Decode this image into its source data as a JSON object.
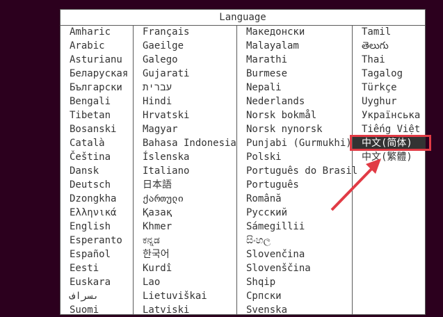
{
  "dialog": {
    "title": "Language",
    "columns": [
      [
        "Amharic",
        "Arabic",
        "Asturianu",
        "Беларуская",
        "Български",
        "Bengali",
        "Tibetan",
        "Bosanski",
        "Català",
        "Čeština",
        "Dansk",
        "Deutsch",
        "Dzongkha",
        "Ελληνικά",
        "English",
        "Esperanto",
        "Español",
        "Eesti",
        "Euskara",
        "ىسراف",
        "Suomi"
      ],
      [
        "Français",
        "Gaeilge",
        "Galego",
        "Gujarati",
        "עברית",
        "Hindi",
        "Hrvatski",
        "Magyar",
        "Bahasa Indonesia",
        "Íslenska",
        "Italiano",
        "日本語",
        "ქართული",
        "Қазақ",
        "Khmer",
        "ಕನ್ನಡ",
        "한국어",
        "Kurdî",
        "Lao",
        "Lietuviškai",
        "Latviski"
      ],
      [
        "Македонски",
        "Malayalam",
        "Marathi",
        "Burmese",
        "Nepali",
        "Nederlands",
        "Norsk bokmål",
        "Norsk nynorsk",
        "Punjabi (Gurmukhi)",
        "Polski",
        "Português do Brasil",
        "Português",
        "Română",
        "Русский",
        "Sámegillii",
        "සිංහල",
        "Slovenčina",
        "Slovenščina",
        "Shqip",
        "Српски",
        "Svenska"
      ],
      [
        "Tamil",
        "తెలుగు",
        "Thai",
        "Tagalog",
        "Türkçe",
        "Uyghur",
        "Українська",
        "Tiếng Việt",
        "中文(简体)",
        "中文(繁體)"
      ]
    ],
    "selected": "中文(简体)"
  },
  "annotation": {
    "box_color": "#e13b45",
    "arrow_color": "#e13b45"
  }
}
